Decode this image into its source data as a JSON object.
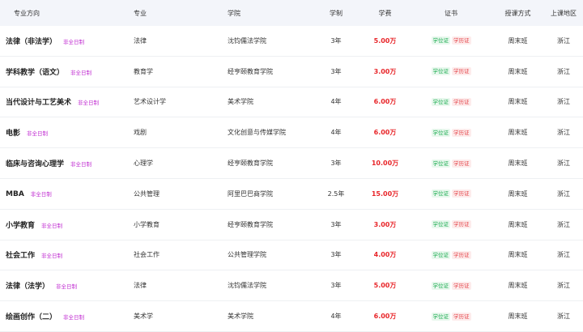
{
  "headers": {
    "direction": "专业方向",
    "major": "专业",
    "school": "学院",
    "years": "学制",
    "fee": "学费",
    "certs": "证书",
    "mode": "授课方式",
    "region": "上课地区"
  },
  "rows": [
    {
      "direction": "法律（非法学）",
      "tag": "非全日制",
      "major": "法律",
      "school": "沈钧儒法学院",
      "years": "3年",
      "fee": "5.00万",
      "cert1": "学位证",
      "cert2": "学历证",
      "mode": "周末班",
      "region": "浙江"
    },
    {
      "direction": "学科教学（语文）",
      "tag": "非全日制",
      "major": "教育学",
      "school": "经亨颐教育学院",
      "years": "3年",
      "fee": "3.00万",
      "cert1": "学位证",
      "cert2": "学历证",
      "mode": "周末班",
      "region": "浙江"
    },
    {
      "direction": "当代设计与工艺美术",
      "tag": "非全日制",
      "major": "艺术设计学",
      "school": "美术学院",
      "years": "4年",
      "fee": "6.00万",
      "cert1": "学位证",
      "cert2": "学历证",
      "mode": "周末班",
      "region": "浙江"
    },
    {
      "direction": "电影",
      "tag": "非全日制",
      "major": "戏剧",
      "school": "文化创意与传媒学院",
      "years": "4年",
      "fee": "6.00万",
      "cert1": "学位证",
      "cert2": "学历证",
      "mode": "周末班",
      "region": "浙江"
    },
    {
      "direction": "临床与咨询心理学",
      "tag": "非全日制",
      "major": "心理学",
      "school": "经亨颐教育学院",
      "years": "3年",
      "fee": "10.00万",
      "cert1": "学位证",
      "cert2": "学历证",
      "mode": "周末班",
      "region": "浙江"
    },
    {
      "direction": "MBA",
      "tag": "非全日制",
      "major": "公共管理",
      "school": "阿里巴巴商学院",
      "years": "2.5年",
      "fee": "15.00万",
      "cert1": "学位证",
      "cert2": "学历证",
      "mode": "周末班",
      "region": "浙江"
    },
    {
      "direction": "小学教育",
      "tag": "非全日制",
      "major": "小学教育",
      "school": "经亨颐教育学院",
      "years": "3年",
      "fee": "3.00万",
      "cert1": "学位证",
      "cert2": "学历证",
      "mode": "周末班",
      "region": "浙江"
    },
    {
      "direction": "社会工作",
      "tag": "非全日制",
      "major": "社会工作",
      "school": "公共管理学院",
      "years": "3年",
      "fee": "4.00万",
      "cert1": "学位证",
      "cert2": "学历证",
      "mode": "周末班",
      "region": "浙江"
    },
    {
      "direction": "法律（法学）",
      "tag": "非全日制",
      "major": "法律",
      "school": "沈钧儒法学院",
      "years": "3年",
      "fee": "5.00万",
      "cert1": "学位证",
      "cert2": "学历证",
      "mode": "周末班",
      "region": "浙江"
    },
    {
      "direction": "绘画创作（二）",
      "tag": "非全日制",
      "major": "美术学",
      "school": "美术学院",
      "years": "4年",
      "fee": "6.00万",
      "cert1": "学位证",
      "cert2": "学历证",
      "mode": "周末班",
      "region": "浙江"
    }
  ]
}
